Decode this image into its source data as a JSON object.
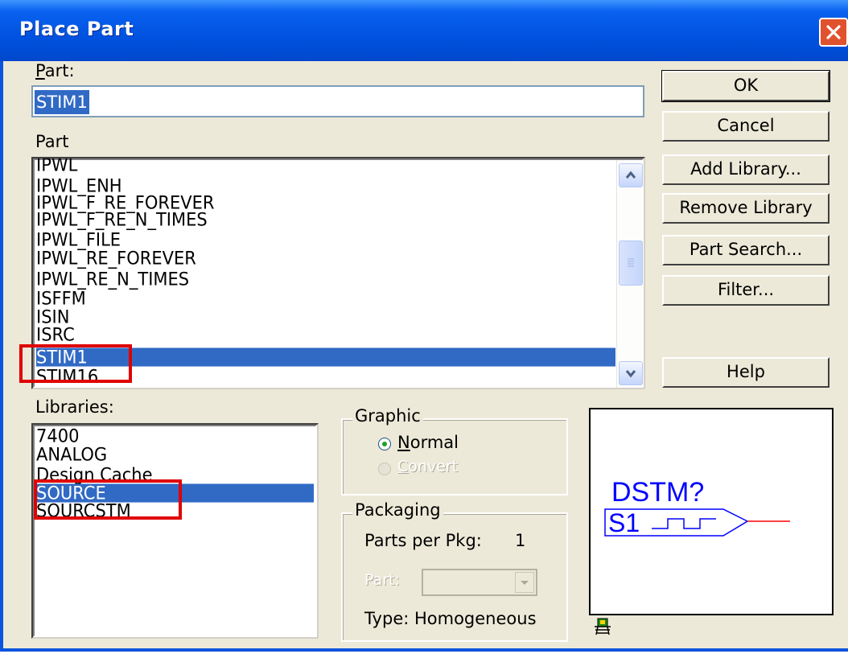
{
  "window": {
    "title": "Place Part"
  },
  "part_field": {
    "label": "Part:",
    "value": "STIM1"
  },
  "part_list": {
    "label": "Part",
    "items": [
      "IPWL",
      "IPWL_ENH",
      "IPWL_F_RE_FOREVER",
      "IPWL_F_RE_N_TIMES",
      "IPWL_FILE",
      "IPWL_RE_FOREVER",
      "IPWL_RE_N_TIMES",
      "ISFFM",
      "ISIN",
      "ISRC",
      "STIM1",
      "STIM16"
    ],
    "selected": "STIM1"
  },
  "libraries": {
    "label": "Libraries:",
    "items": [
      "7400",
      "ANALOG",
      "Design Cache",
      "SOURCE",
      "SOURCSTM"
    ],
    "selected": "SOURCE"
  },
  "buttons": {
    "ok": "OK",
    "cancel": "Cancel",
    "add_library": "Add Library...",
    "remove_library": "Remove Library",
    "part_search": "Part Search...",
    "filter": "Filter...",
    "help": "Help"
  },
  "graphic": {
    "title": "Graphic",
    "normal": "Normal",
    "convert": "Convert",
    "selected": "Normal"
  },
  "packaging": {
    "title": "Packaging",
    "parts_per_pkg_label": "Parts per Pkg:",
    "parts_per_pkg_value": "1",
    "part_label": "Part:",
    "part_value": "",
    "type": "Type: Homogeneous"
  },
  "preview": {
    "ref": "DSTM?",
    "pin_name": "S1"
  },
  "colors": {
    "title_bar": "#0a54de",
    "selection": "#316ac5",
    "highlight_box": "#e00000",
    "symbol_blue": "#0000ff",
    "symbol_red": "#ff0000"
  }
}
